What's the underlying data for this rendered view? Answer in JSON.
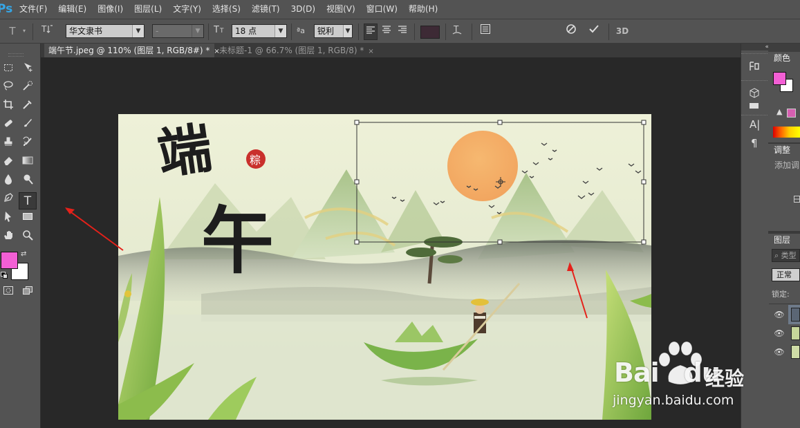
{
  "app": {
    "logo": "Ps"
  },
  "menu": [
    "文件(F)",
    "编辑(E)",
    "图像(I)",
    "图层(L)",
    "文字(Y)",
    "选择(S)",
    "滤镜(T)",
    "3D(D)",
    "视图(V)",
    "窗口(W)",
    "帮助(H)"
  ],
  "options": {
    "font_family": "华文隶书",
    "font_style": "-",
    "font_size": "18 点",
    "aa_label": "ªa",
    "antialias": "锐利",
    "text_color": "#3d2a35"
  },
  "tabs": [
    {
      "label": "端午节.jpeg @ 110% (图层 1, RGB/8#) *",
      "close": "×"
    },
    {
      "label": "未标题-1 @ 66.7% (图层 1, RGB/8) *",
      "close": "×"
    }
  ],
  "colors": {
    "foreground": "#f35fd5",
    "background": "#ffffff",
    "arrow": "#e5211a"
  },
  "panels": {
    "color_tab": "颜色",
    "adjust_tab": "调整",
    "adjust_add": "添加调",
    "layers_tab": "图层",
    "layers_search": "类型",
    "blend_mode": "正常",
    "lock_label": "锁定:",
    "collapse_glyph": "«"
  },
  "artwork": {
    "title_char_1": "端",
    "title_char_2": "午",
    "seal_char": "粽"
  },
  "watermark": {
    "brand": "Bai",
    "brand2": "du",
    "cn": "经验",
    "url": "jingyan.baidu.com"
  }
}
